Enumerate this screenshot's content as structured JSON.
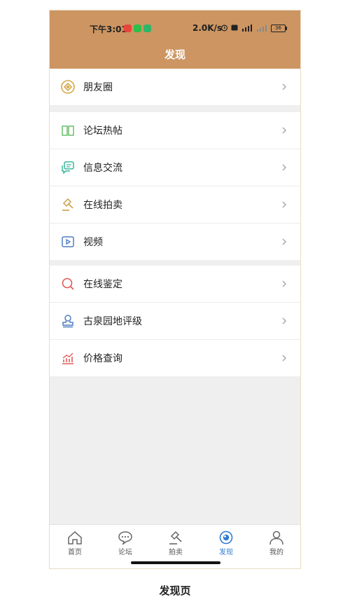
{
  "status_bar": {
    "time": "下午3:01",
    "net_speed": "2.0K/s",
    "battery": "36"
  },
  "header": {
    "title": "发现"
  },
  "sections": [
    {
      "items": [
        {
          "label": "朋友圈",
          "icon": "moments-icon",
          "color": "#d4a74a"
        }
      ]
    },
    {
      "items": [
        {
          "label": "论坛热帖",
          "icon": "book-icon",
          "color": "#6bbf6b"
        },
        {
          "label": "信息交流",
          "icon": "chat-icon",
          "color": "#3bb59c"
        },
        {
          "label": "在线拍卖",
          "icon": "gavel-icon",
          "color": "#c9a04a"
        },
        {
          "label": "视频",
          "icon": "video-icon",
          "color": "#4f7fbf"
        }
      ]
    },
    {
      "items": [
        {
          "label": "在线鉴定",
          "icon": "search-icon",
          "color": "#e05a5a"
        },
        {
          "label": "古泉园地评级",
          "icon": "stamp-icon",
          "color": "#4f7fbf"
        },
        {
          "label": "价格查询",
          "icon": "chart-icon",
          "color": "#e05a5a"
        }
      ]
    }
  ],
  "bottom_nav": [
    {
      "label": "首页",
      "icon": "home-icon"
    },
    {
      "label": "论坛",
      "icon": "forum-icon"
    },
    {
      "label": "拍卖",
      "icon": "gavel-icon"
    },
    {
      "label": "发现",
      "icon": "discover-icon",
      "active": true
    },
    {
      "label": "我的",
      "icon": "user-icon"
    }
  ],
  "caption": "发现页"
}
